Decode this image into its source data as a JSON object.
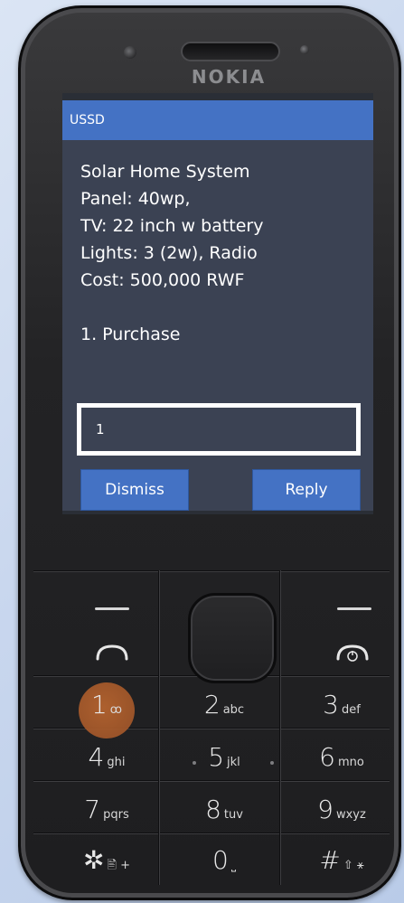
{
  "phone": {
    "brand": "NOKIA"
  },
  "ussd": {
    "title": "USSD",
    "message_lines": [
      "Solar Home System",
      "Panel: 40wp,",
      "TV: 22 inch w battery",
      "Lights: 3 (2w), Radio",
      "Cost: 500,000 RWF",
      "1. Purchase"
    ],
    "input_value": "1",
    "dismiss_label": "Dismiss",
    "reply_label": "Reply"
  },
  "keypad": {
    "keys": [
      {
        "num": "1",
        "sub": "ꝏ"
      },
      {
        "num": "2",
        "sub": "abc"
      },
      {
        "num": "3",
        "sub": "def"
      },
      {
        "num": "4",
        "sub": "ghi"
      },
      {
        "num": "5",
        "sub": "jkl"
      },
      {
        "num": "6",
        "sub": "mno"
      },
      {
        "num": "7",
        "sub": "pqrs"
      },
      {
        "num": "8",
        "sub": "tuv"
      },
      {
        "num": "9",
        "sub": "wxyz"
      },
      {
        "num": "✲",
        "sub": "🖹 +"
      },
      {
        "num": "0",
        "sub": "⎵"
      },
      {
        "num": "#",
        "sub": "⇧ ⚹"
      }
    ]
  },
  "colors": {
    "accent": "#4472c4",
    "screen_bg": "#3b4253",
    "voicemail_highlight": "#b9652f"
  }
}
